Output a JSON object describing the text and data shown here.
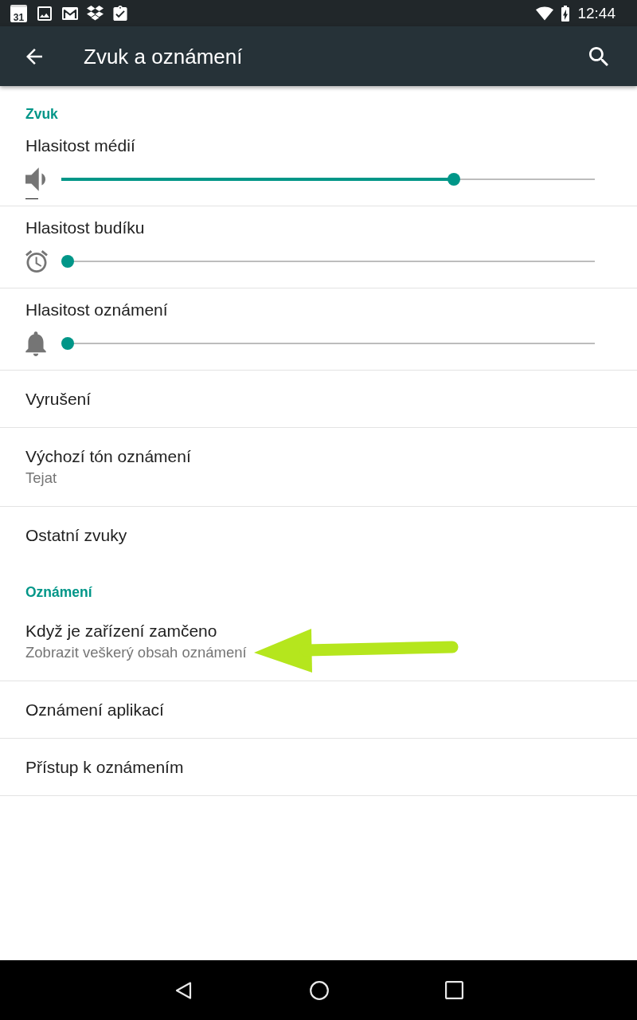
{
  "status_bar": {
    "calendar_day": "31",
    "time": "12:44"
  },
  "app_bar": {
    "title": "Zvuk a oznámení"
  },
  "sections": [
    {
      "title": "Zvuk",
      "items": [
        {
          "kind": "slider",
          "title": "Hlasitost médií",
          "level": 0.733,
          "focused": true
        },
        {
          "kind": "slider",
          "title": "Hlasitost budíku",
          "level": 0,
          "focused": false
        },
        {
          "kind": "slider",
          "title": "Hlasitost oznámení",
          "level": 0,
          "focused": false
        },
        {
          "kind": "link",
          "title": "Vyrušení"
        },
        {
          "kind": "link",
          "title": "Výchozí tón oznámení",
          "summary": "Tejat"
        },
        {
          "kind": "link",
          "title": "Ostatní zvuky"
        }
      ]
    },
    {
      "title": "Oznámení",
      "items": [
        {
          "kind": "link",
          "title": "Když je zařízení zamčeno",
          "summary": "Zobrazit veškerý obsah oznámení",
          "arrow": true
        },
        {
          "kind": "link",
          "title": "Oznámení aplikací"
        },
        {
          "kind": "link",
          "title": "Přístup k oznámením"
        }
      ]
    }
  ]
}
